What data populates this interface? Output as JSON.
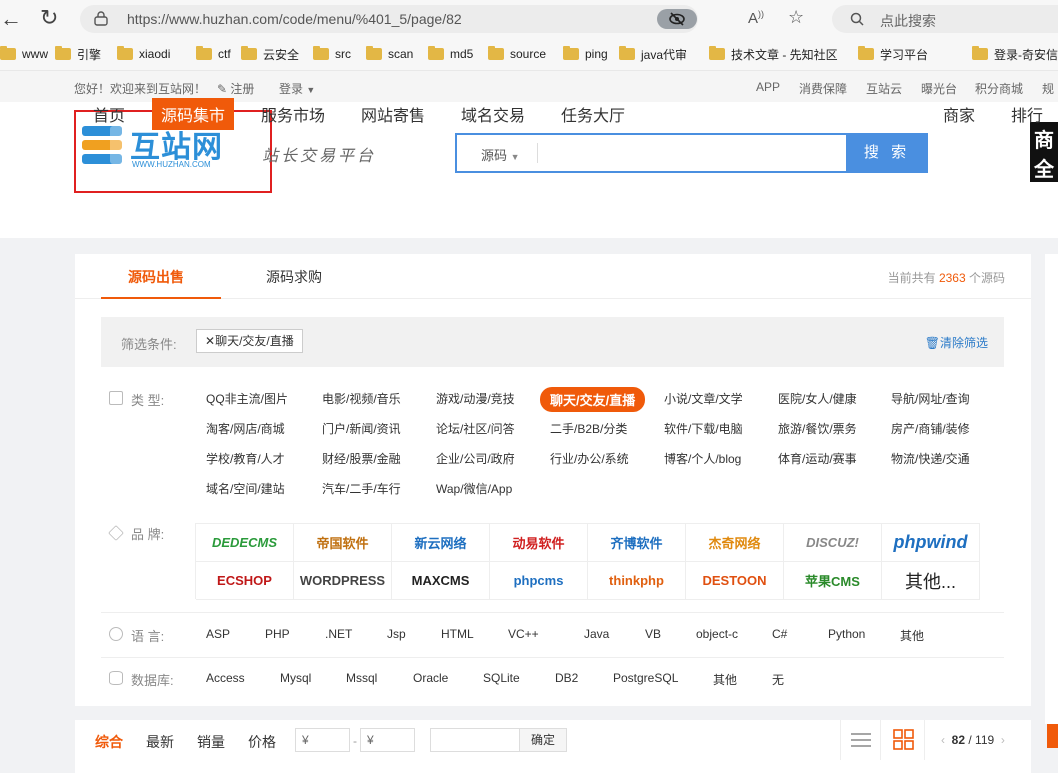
{
  "browser": {
    "url": "https://www.huzhan.com/code/menu/%401_5/page/82",
    "search_placeholder": "点此搜索",
    "bookmarks": [
      "www",
      "引擎",
      "xiaodi",
      "ctf",
      "云安全",
      "src",
      "scan",
      "md5",
      "source",
      "ping",
      "java代审",
      "技术文章 - 先知社区",
      "学习平台",
      "登录-奇安信"
    ]
  },
  "topbar": {
    "welcome": "您好！欢迎来到互站网！",
    "register": "注册",
    "login": "登录",
    "links": [
      "APP",
      "消费保障",
      "互站云",
      "曝光台",
      "积分商城",
      "规"
    ]
  },
  "header": {
    "logo_text": "互站网",
    "logo_sub": "WWW.HUZHAN.COM",
    "slogan": "站长交易平台",
    "search_select": "源码",
    "search_button": "搜 索",
    "ad_text": "商全"
  },
  "nav": {
    "items": [
      "首页",
      "源码集市",
      "服务市场",
      "网站寄售",
      "域名交易",
      "任务大厅",
      "商家",
      "排行"
    ],
    "active_index": 1
  },
  "panel": {
    "tabs": [
      "源码出售",
      "源码求购"
    ],
    "count_prefix": "当前共有",
    "count_value": "2363",
    "count_suffix": "个源码",
    "filter_label": "筛选条件:",
    "filter_chip": "聊天/交友/直播",
    "clear_label": "清除筛选",
    "type_label": "类    型:",
    "categories": [
      [
        "QQ非主流/图片",
        "电影/视频/音乐",
        "游戏/动漫/竞技",
        "聊天/交友/直播",
        "小说/文章/文学",
        "医院/女人/健康",
        "导航/网址/查询"
      ],
      [
        "淘客/网店/商城",
        "门户/新闻/资讯",
        "论坛/社区/问答",
        "二手/B2B/分类",
        "软件/下载/电脑",
        "旅游/餐饮/票务",
        "房产/商铺/装修"
      ],
      [
        "学校/教育/人才",
        "财经/股票/金融",
        "企业/公司/政府",
        "行业/办公/系统",
        "博客/个人/blog",
        "体育/运动/赛事",
        "物流/快递/交通"
      ],
      [
        "域名/空间/建站",
        "汽车/二手/车行",
        "Wap/微信/App"
      ]
    ],
    "active_category": "聊天/交友/直播",
    "brand_label": "品    牌:",
    "brands": [
      [
        "DEDECMS",
        "帝国软件",
        "新云网络",
        "动易软件",
        "齐博软件",
        "杰奇网络",
        "DISCUZ!",
        "phpwind"
      ],
      [
        "ECSHOP",
        "WORDPRESS",
        "MAXCMS",
        "phpcms",
        "thinkphp",
        "DESTOON",
        "苹果CMS",
        "其他..."
      ]
    ],
    "lang_label": "语    言:",
    "languages": [
      "ASP",
      "PHP",
      ".NET",
      "Jsp",
      "HTML",
      "VC++",
      "Java",
      "VB",
      "object-c",
      "C#",
      "Python",
      "其他"
    ],
    "db_label": "数据库:",
    "databases": [
      "Access",
      "Mysql",
      "Mssql",
      "Oracle",
      "SQLite",
      "DB2",
      "PostgreSQL",
      "其他",
      "无"
    ]
  },
  "sortbar": {
    "items": [
      "综合",
      "最新",
      "销量",
      "价格"
    ],
    "price_min": "¥",
    "price_max": "¥",
    "confirm": "确定",
    "page_current": "82",
    "page_total": "119"
  },
  "colors": {
    "accent": "#f05a0a",
    "search_blue": "#4a8fe0",
    "link_blue": "#2a7ac8"
  }
}
